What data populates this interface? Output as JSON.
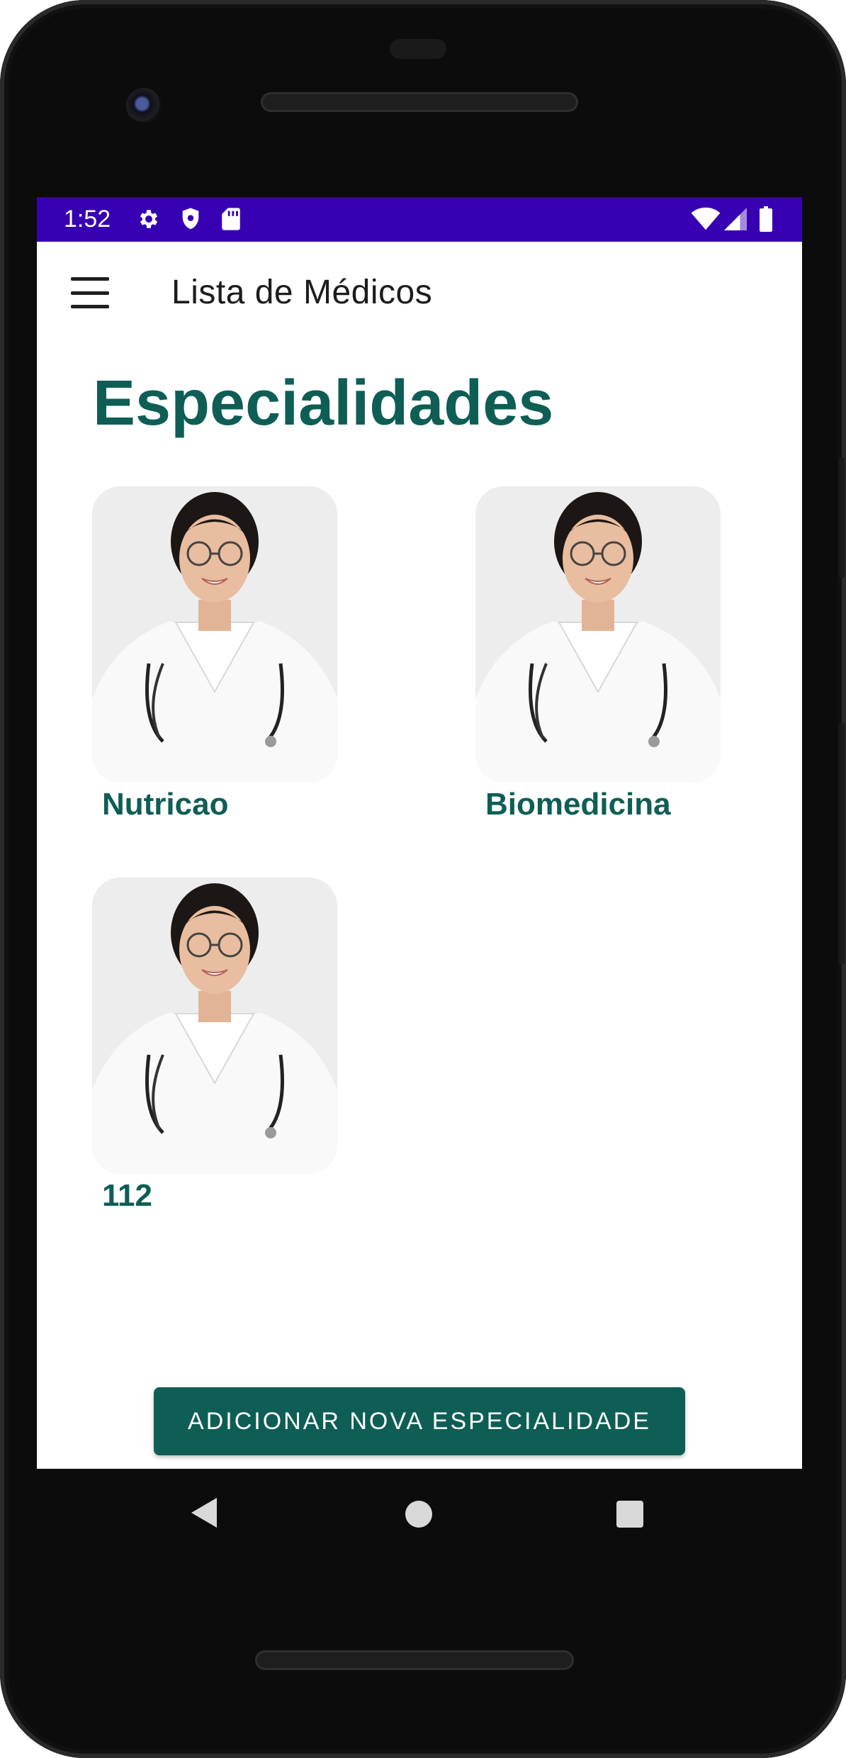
{
  "status_bar": {
    "time": "1:52",
    "background": "#3700b3",
    "left_icons": [
      "settings-icon",
      "shield-icon",
      "sd-card-icon"
    ],
    "right_icons": [
      "wifi-icon",
      "signal-icon",
      "battery-icon"
    ]
  },
  "app_bar": {
    "title": "Lista de Médicos",
    "menu_icon": "hamburger-menu-icon"
  },
  "page": {
    "heading": "Especialidades",
    "accent_color": "#0e5e55"
  },
  "specialties": [
    {
      "label": "Nutricao",
      "image": "doctor-photo"
    },
    {
      "label": "Biomedicina",
      "image": "doctor-photo"
    },
    {
      "label": "112",
      "image": "doctor-photo"
    }
  ],
  "actions": {
    "add_label": "ADICIONAR NOVA ESPECIALIDADE"
  },
  "nav_bar": {
    "icons": [
      "back-icon",
      "home-icon",
      "recents-icon"
    ]
  }
}
